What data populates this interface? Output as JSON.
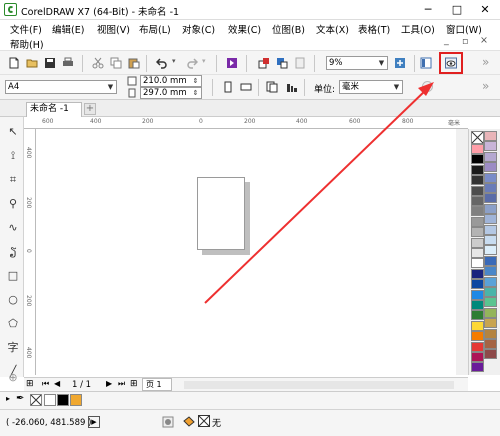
{
  "window": {
    "title": "CorelDRAW X7 (64-Bit) - 未命名 -1",
    "minimize": "─",
    "restore": "□",
    "close": "✕"
  },
  "menu": {
    "row1": [
      "文件(F)",
      "编辑(E)",
      "视图(V)",
      "布局(L)",
      "对象(C)",
      "效果(C)",
      "位图(B)",
      "文本(X)",
      "表格(T)",
      "工具(O)",
      "窗口(W)"
    ],
    "row2": [
      "帮助(H)"
    ],
    "inner_min": "_",
    "inner_restore": "▫",
    "inner_close": "×"
  },
  "toolbar": {
    "zoom_value": "9%"
  },
  "property_bar": {
    "paper_size": "A4",
    "width": "210.0 mm",
    "height": "297.0 mm",
    "unit_label": "单位:",
    "unit_value": "毫米"
  },
  "document_tab": {
    "name": "未命名 -1",
    "add": "+"
  },
  "rulers": {
    "h_ticks": [
      "600",
      "400",
      "200",
      "0",
      "200",
      "400",
      "600",
      "800",
      "毫米"
    ],
    "v_ticks": [
      "400",
      "200",
      "0",
      "200",
      "400"
    ]
  },
  "page_nav": {
    "counter": "1 / 1",
    "page_tab": "页 1"
  },
  "palette_colors": [
    "#ff9ea8",
    "#000000",
    "#1a1a1a",
    "#333333",
    "#4d4d4d",
    "#666666",
    "#808080",
    "#999999",
    "#b3b3b3",
    "#cccccc",
    "#e6e6e6",
    "#ffffff",
    "#1a237e",
    "#0d47a1",
    "#1e88e5",
    "#00897b",
    "#2e7d32",
    "#fdd835",
    "#f57c00",
    "#e53935",
    "#ad1457",
    "#6a1b9a"
  ],
  "palette_colors2": [
    "#e8b4b8",
    "#c8b4d8",
    "#b4a8d0",
    "#9c8cc4",
    "#7a8cc8",
    "#6a7cb8",
    "#5a6ca8",
    "#8ca0c8",
    "#a0b4d8",
    "#b4c8e4",
    "#c8dcf0",
    "#dceefa",
    "#3a6ab8",
    "#4a86c8",
    "#5aa2d8",
    "#4ab4a8",
    "#5ac490",
    "#94b45a",
    "#c8a450",
    "#b48440",
    "#a46444",
    "#8c4a4a"
  ],
  "color_bar": {
    "swatches": [
      "#ffffff",
      "#000000",
      "#f0a830"
    ]
  },
  "status": {
    "coords": "( -26.060, 481.589 )",
    "fill_label": "无"
  },
  "accent": {
    "highlight": "#e02020",
    "arrow": "#ee3030"
  }
}
